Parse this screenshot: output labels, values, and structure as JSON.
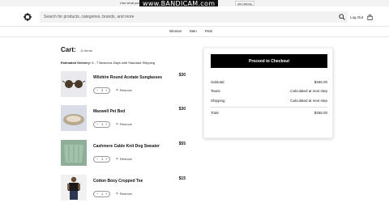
{
  "promo": {
    "text": "Like what you see?",
    "watermark": "www.BANDICAM.com",
    "right_text": "ols history"
  },
  "header": {
    "search_placeholder": "Search for products, categories, brands, and more",
    "logout_label": "Log Out"
  },
  "nav": [
    "Women",
    "Men",
    "Pets"
  ],
  "cart": {
    "title": "Cart:",
    "count": "11 items",
    "delivery_label": "Estimated Delivery:",
    "delivery_text": "5 - 7 Business Days with Standard Shipping",
    "remove_label": "Remove",
    "items": [
      {
        "name": "Wilshire Round Acetate Sunglasses",
        "price": "$30",
        "qty": "3",
        "thumb_icon": "sunglasses-image",
        "bg": "#e9e9ee"
      },
      {
        "name": "Maxwell Pet Bed",
        "price": "$30",
        "qty": "1",
        "thumb_icon": "pet-bed-image",
        "bg": "#d9dde7"
      },
      {
        "name": "Cashmere Cable Knit Dog Sweater",
        "price": "$55",
        "qty": "1",
        "thumb_icon": "dog-sweater-image",
        "bg": "#8fae98"
      },
      {
        "name": "Cotton Boxy Cropped Tee",
        "price": "$15",
        "qty": "1",
        "thumb_icon": "cropped-tee-image",
        "bg": "#f1f1f1"
      }
    ]
  },
  "summary": {
    "checkout_label": "Proceed to Checkout",
    "subtotal_label": "Subtotal",
    "subtotal_value": "$465.00",
    "taxes_label": "Taxes",
    "taxes_value": "Calculated at next step",
    "shipping_label": "Shipping",
    "shipping_value": "Calculated at next step",
    "total_label": "Total",
    "total_value": "$465.00"
  }
}
